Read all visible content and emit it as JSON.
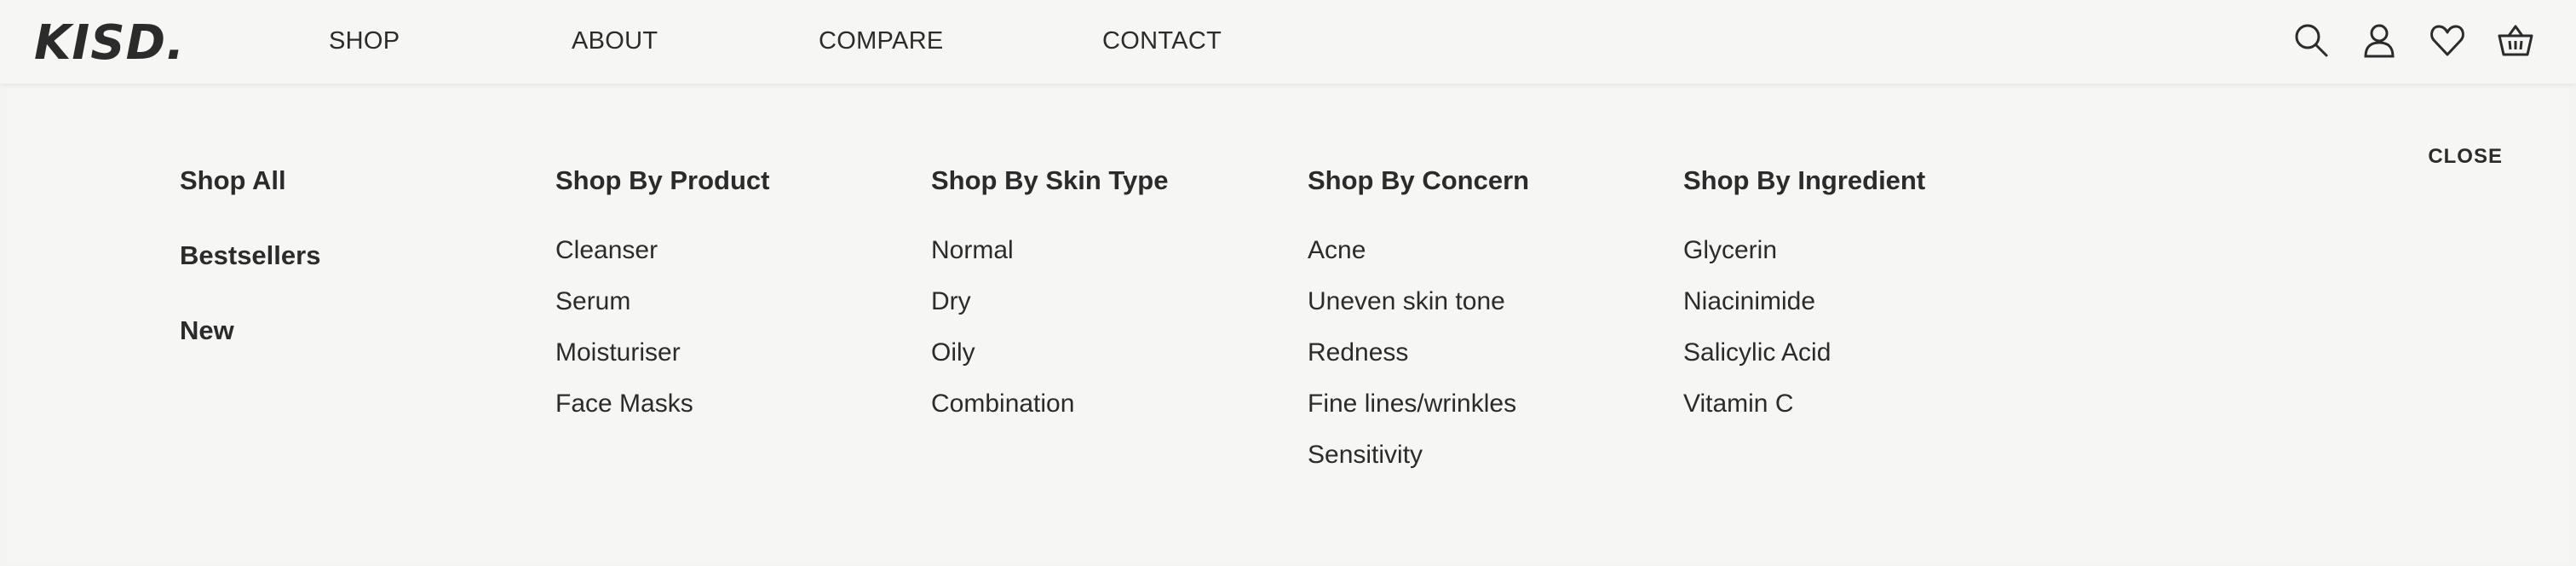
{
  "brand": {
    "logo": "KISD."
  },
  "nav": [
    "SHOP",
    "ABOUT",
    "COMPARE",
    "CONTACT"
  ],
  "header_icons": [
    "search-icon",
    "account-icon",
    "wishlist-icon",
    "basket-icon"
  ],
  "mega_menu": {
    "close_label": "CLOSE",
    "shop_links": [
      "Shop All",
      "Bestsellers",
      "New"
    ],
    "columns": [
      {
        "heading": "Shop By Product",
        "items": [
          "Cleanser",
          "Serum",
          "Moisturiser",
          "Face Masks"
        ]
      },
      {
        "heading": "Shop By Skin Type",
        "items": [
          "Normal",
          "Dry",
          "Oily",
          "Combination"
        ]
      },
      {
        "heading": "Shop By Concern",
        "items": [
          "Acne",
          "Uneven skin tone",
          "Redness",
          "Fine lines/wrinkles",
          "Sensitivity"
        ]
      },
      {
        "heading": "Shop By Ingredient",
        "items": [
          "Glycerin",
          "Niacinimide",
          "Salicylic Acid",
          "Vitamin C"
        ]
      }
    ]
  },
  "colors": {
    "background": "#f6f6f4",
    "text": "#2b2b2b"
  }
}
